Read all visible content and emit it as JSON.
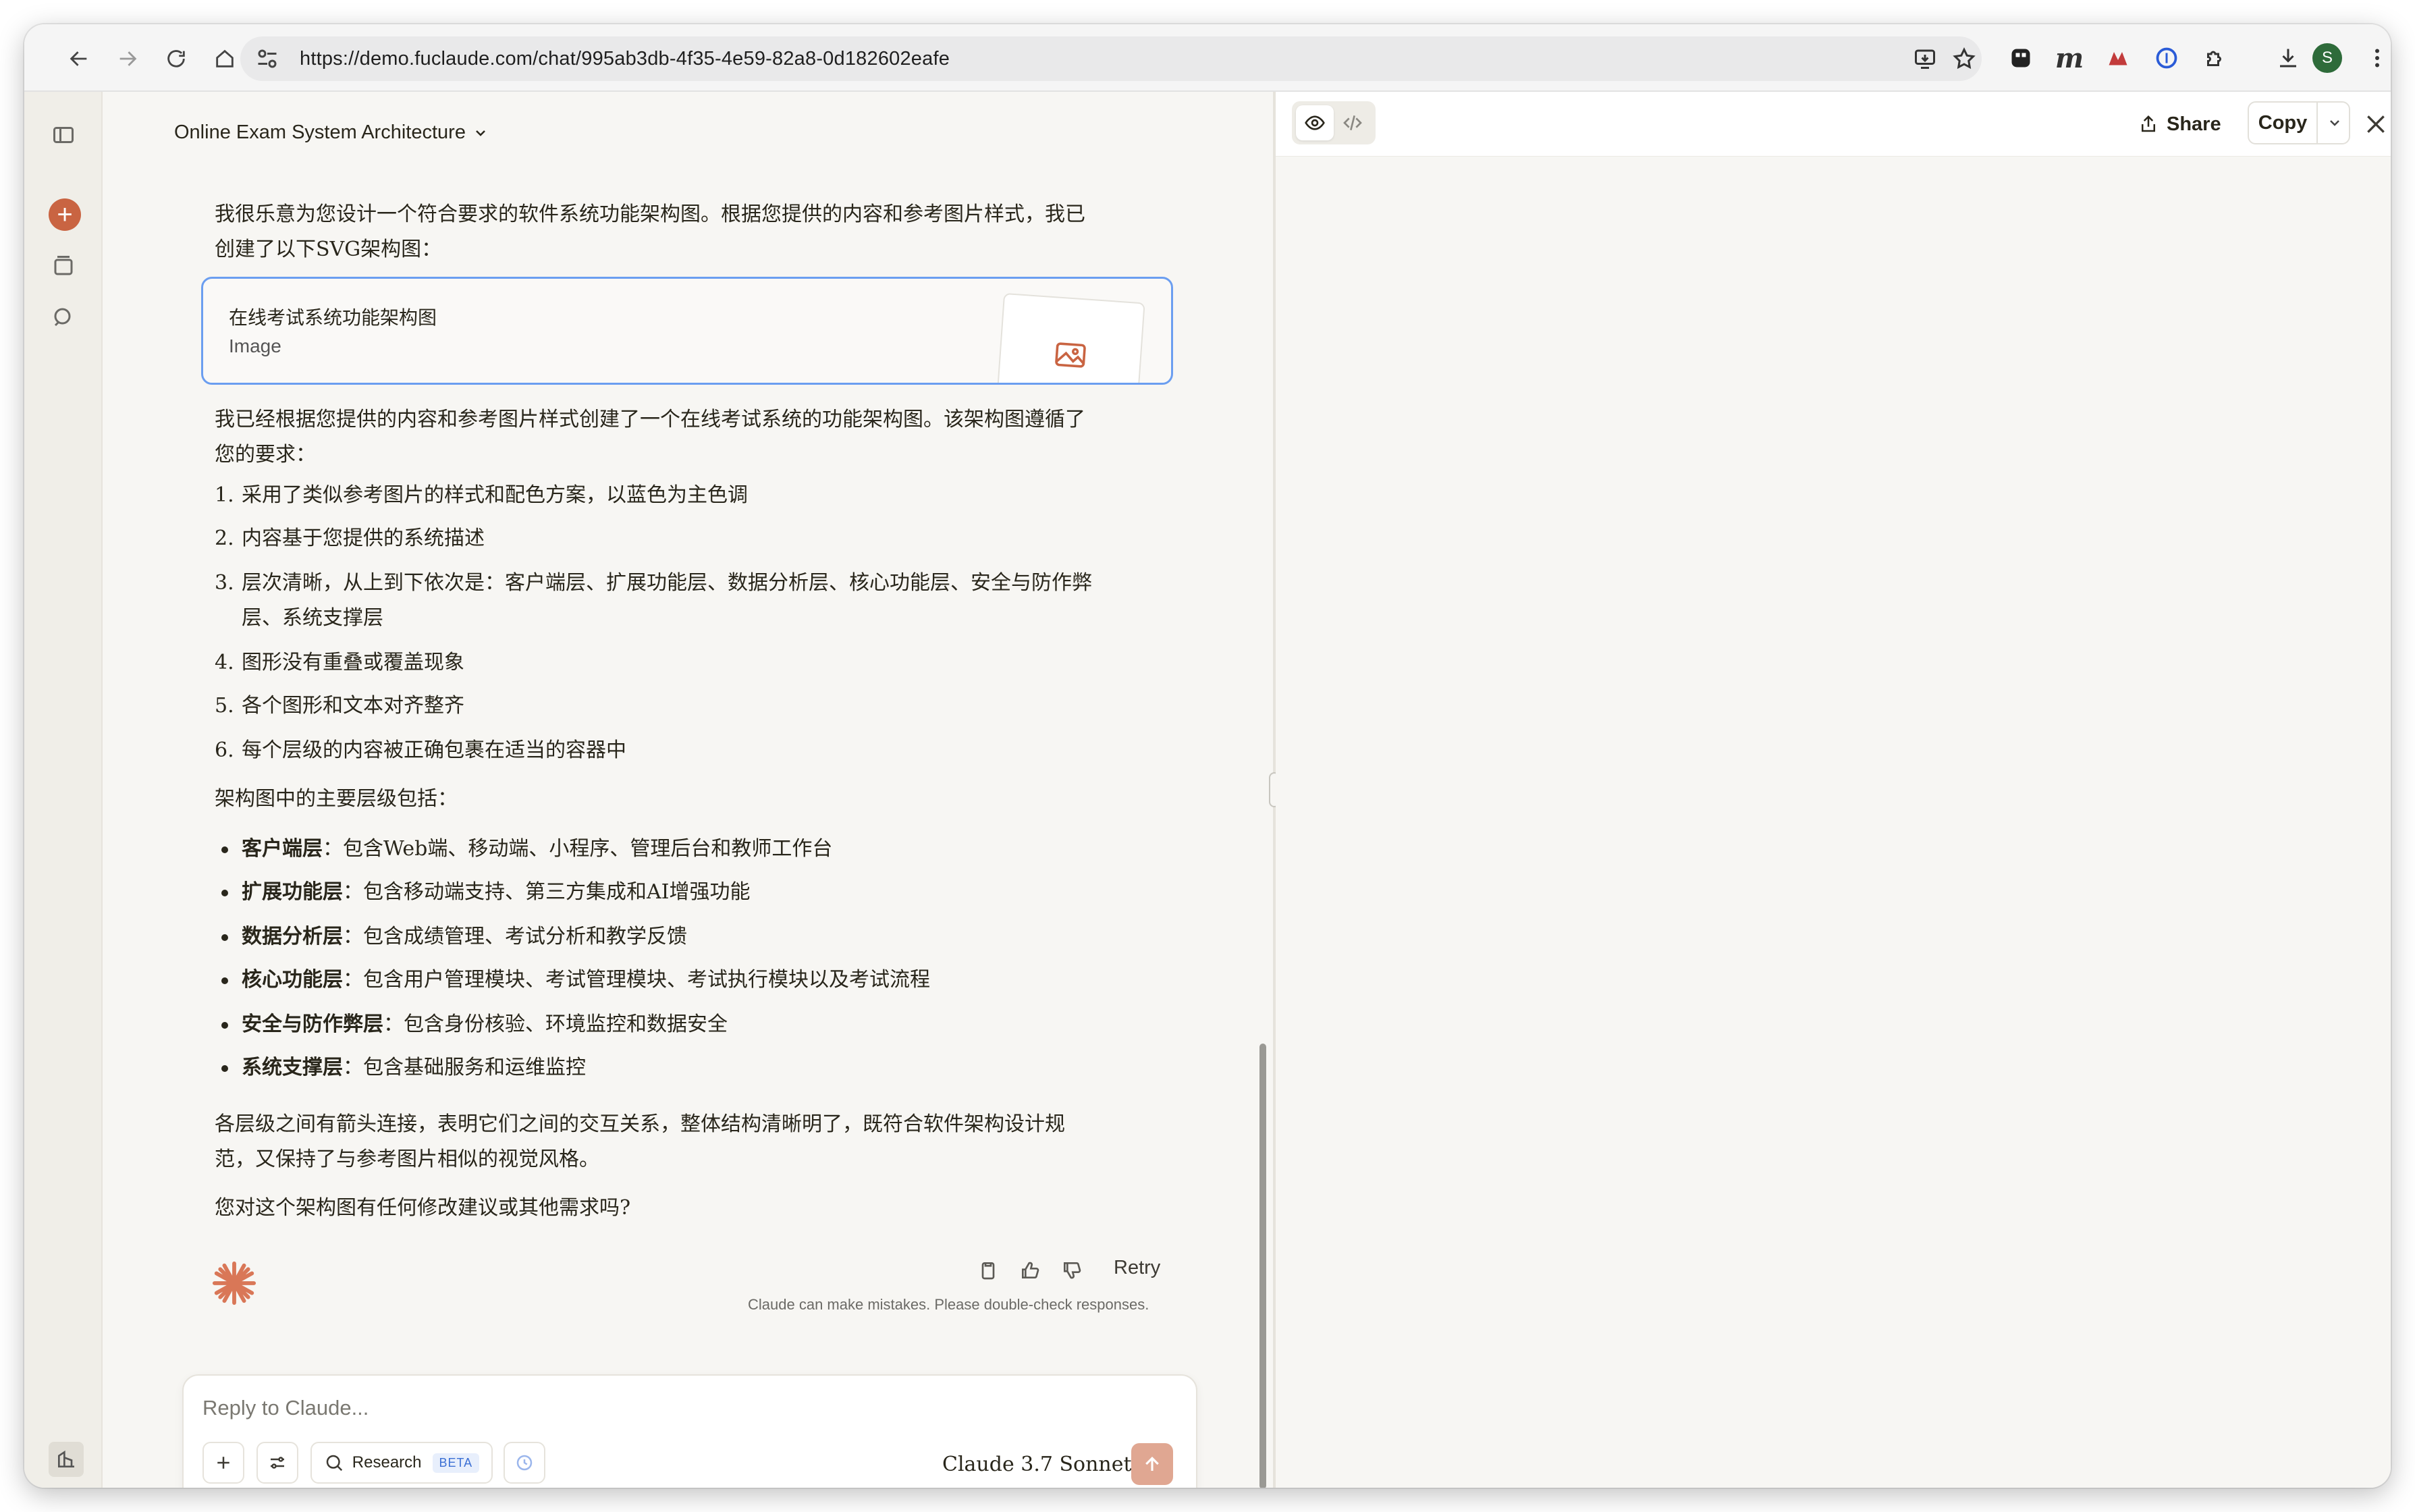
{
  "browser": {
    "url": "https://demo.fuclaude.com/chat/995ab3db-4f35-4e59-82a8-0d182602eafe",
    "profile_initial": "S"
  },
  "chat": {
    "title": "Online Exam System Architecture",
    "intro": "我很乐意为您设计一个符合要求的软件系统功能架构图。根据您提供的内容和参考图片样式，我已创建了以下SVG架构图：",
    "artifact": {
      "title": "在线考试系统功能架构图",
      "subtitle": "Image"
    },
    "summary": "我已经根据您提供的内容和参考图片样式创建了一个在线考试系统的功能架构图。该架构图遵循了您的要求：",
    "requirements": [
      {
        "num": "1.",
        "text": "采用了类似参考图片的样式和配色方案，以蓝色为主色调"
      },
      {
        "num": "2.",
        "text": "内容基于您提供的系统描述"
      },
      {
        "num": "3.",
        "text": "层次清晰，从上到下依次是：客户端层、扩展功能层、数据分析层、核心功能层、安全与防作弊层、系统支撑层"
      },
      {
        "num": "4.",
        "text": "图形没有重叠或覆盖现象"
      },
      {
        "num": "5.",
        "text": "各个图形和文本对齐整齐"
      },
      {
        "num": "6.",
        "text": "每个层级的内容被正确包裹在适当的容器中"
      }
    ],
    "layers_heading": "架构图中的主要层级包括：",
    "layers": [
      {
        "name": "客户端层",
        "desc": "：包含Web端、移动端、小程序、管理后台和教师工作台"
      },
      {
        "name": "扩展功能层",
        "desc": "：包含移动端支持、第三方集成和AI增强功能"
      },
      {
        "name": "数据分析层",
        "desc": "：包含成绩管理、考试分析和教学反馈"
      },
      {
        "name": "核心功能层",
        "desc": "：包含用户管理模块、考试管理模块、考试执行模块以及考试流程"
      },
      {
        "name": "安全与防作弊层",
        "desc": "：包含身份核验、环境监控和数据安全"
      },
      {
        "name": "系统支撑层",
        "desc": "：包含基础服务和运维监控"
      }
    ],
    "closing": "各层级之间有箭头连接，表明它们之间的交互关系，整体结构清晰明了，既符合软件架构设计规范，又保持了与参考图片相似的视觉风格。",
    "question": "您对这个架构图有任何修改建议或其他需求吗?",
    "retry_label": "Retry",
    "disclaimer": "Claude can make mistakes. Please double-check responses."
  },
  "composer": {
    "placeholder": "Reply to Claude...",
    "research_label": "Research",
    "beta_label": "BETA",
    "model": "Claude 3.7 Sonnet"
  },
  "artifact_panel": {
    "share_label": "Share",
    "copy_label": "Copy"
  },
  "colors": {
    "accent": "#c96442",
    "artifact_border": "#6b9ef0",
    "send_button": "#e0a792"
  }
}
